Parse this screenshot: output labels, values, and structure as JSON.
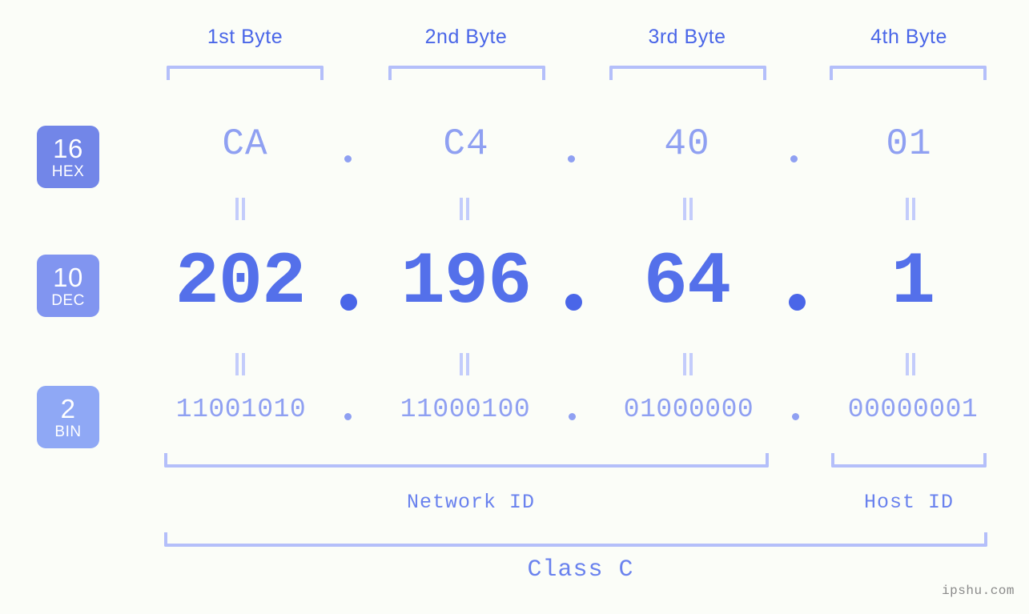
{
  "page": {
    "background_color": "#fbfdf8",
    "accent_color": "#4a66e8",
    "muted_accent_color": "#8fa0f2",
    "bracket_color": "#b4bffa",
    "watermark": "ipshu.com"
  },
  "byte_headers": [
    {
      "label": "1st Byte"
    },
    {
      "label": "2nd Byte"
    },
    {
      "label": "3rd Byte"
    },
    {
      "label": "4th Byte"
    }
  ],
  "bases": [
    {
      "number": "16",
      "abbr": "HEX",
      "color": "#7286e8"
    },
    {
      "number": "10",
      "abbr": "DEC",
      "color": "#8195f0"
    },
    {
      "number": "2",
      "abbr": "BIN",
      "color": "#8fa8f5"
    }
  ],
  "rows": {
    "hex": {
      "values": [
        "CA",
        "C4",
        "40",
        "01"
      ],
      "separator": "."
    },
    "dec": {
      "values": [
        "202",
        "196",
        "64",
        "1"
      ],
      "separator": "."
    },
    "bin": {
      "values": [
        "11001010",
        "11000100",
        "01000000",
        "00000001"
      ],
      "separator": "."
    }
  },
  "equals_symbol": "=",
  "segments": {
    "network_id": "Network ID",
    "host_id": "Host ID",
    "class": "Class C"
  }
}
